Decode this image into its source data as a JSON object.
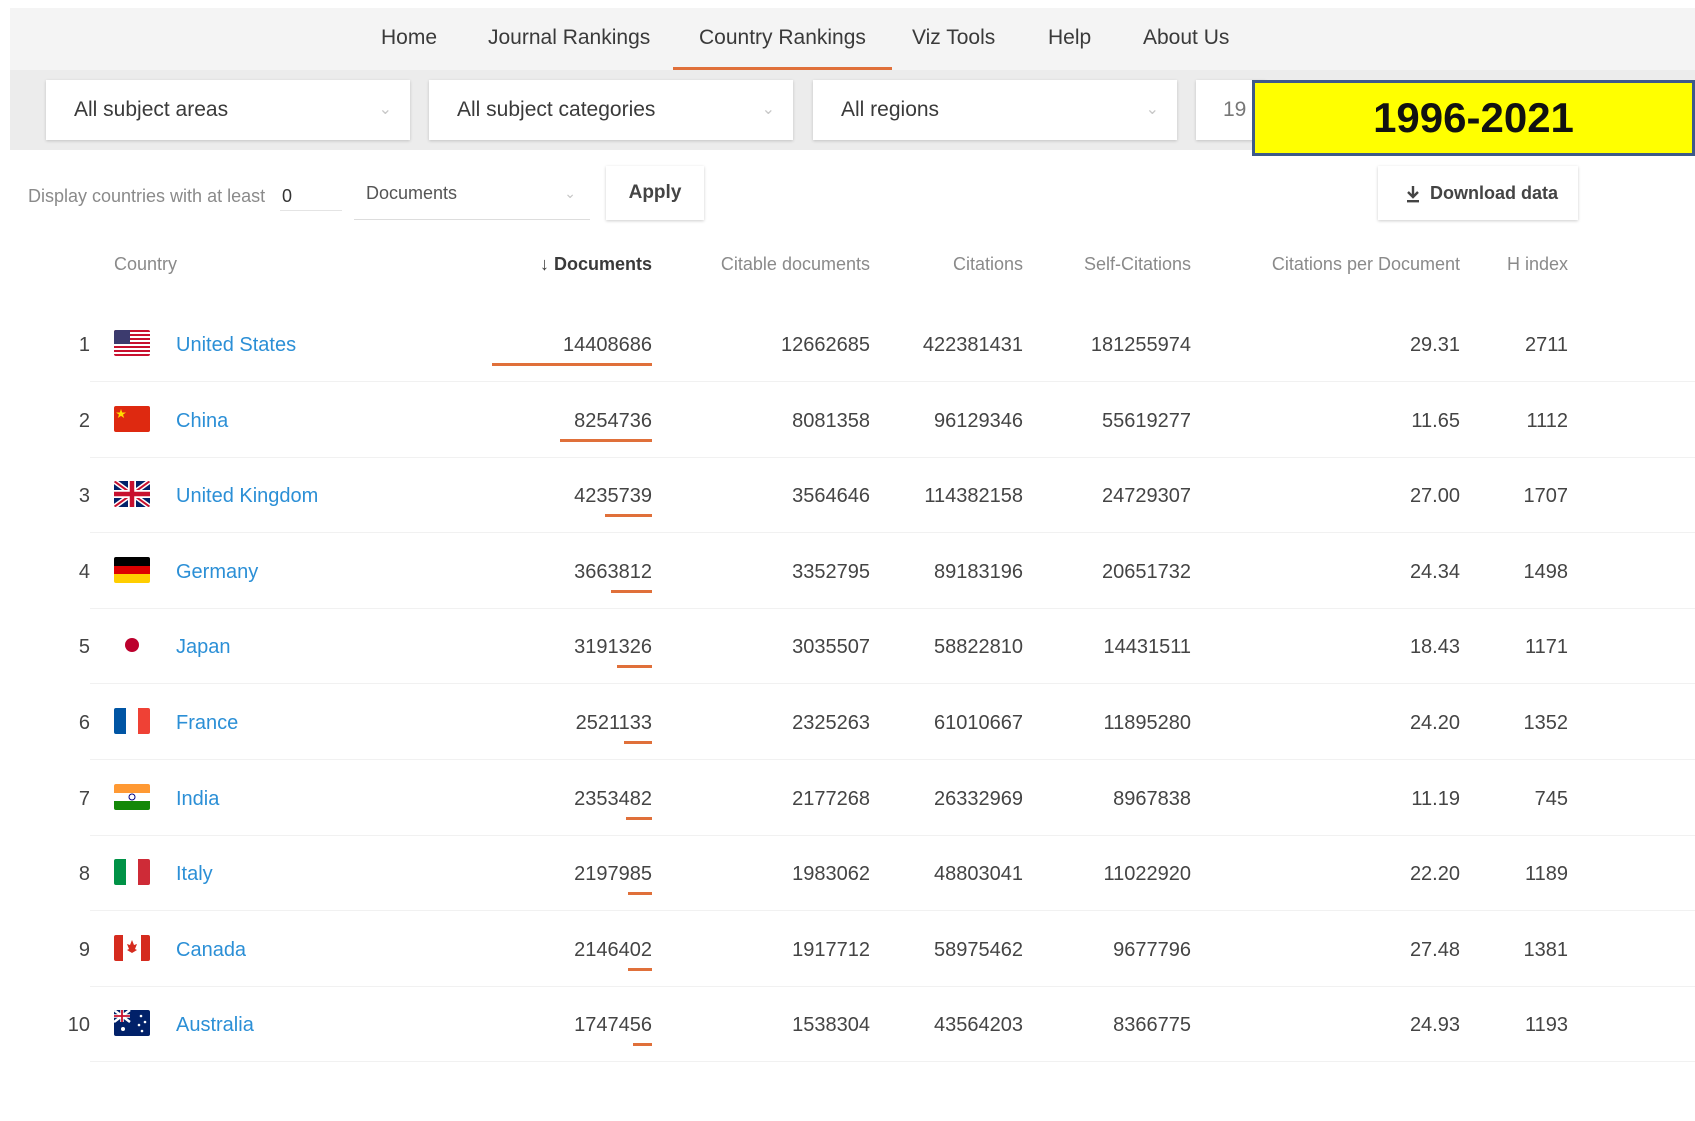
{
  "nav": {
    "items": [
      "Home",
      "Journal Rankings",
      "Country Rankings",
      "Viz Tools",
      "Help",
      "About Us"
    ],
    "active": "Country Rankings"
  },
  "filters": {
    "subject_areas": "All subject areas",
    "subject_categories": "All subject categories",
    "regions": "All regions",
    "year_partial": "19",
    "year_highlight": "1996-2021"
  },
  "options": {
    "display_label": "Display countries with at least",
    "min_value": "0",
    "metric": "Documents",
    "apply_label": "Apply",
    "download_label": "Download data"
  },
  "table": {
    "headers": {
      "country": "Country",
      "documents": "Documents",
      "citable": "Citable documents",
      "citations": "Citations",
      "self_citations": "Self-Citations",
      "cpd": "Citations per Document",
      "hindex": "H index"
    },
    "rows": [
      {
        "rank": "1",
        "country": "United States",
        "flag": "us",
        "documents": "14408686",
        "doc_value": 14408686,
        "citable": "12662685",
        "citations": "422381431",
        "self": "181255974",
        "cpd": "29.31",
        "h": "2711"
      },
      {
        "rank": "2",
        "country": "China",
        "flag": "cn",
        "documents": "8254736",
        "doc_value": 8254736,
        "citable": "8081358",
        "citations": "96129346",
        "self": "55619277",
        "cpd": "11.65",
        "h": "1112"
      },
      {
        "rank": "3",
        "country": "United Kingdom",
        "flag": "gb",
        "documents": "4235739",
        "doc_value": 4235739,
        "citable": "3564646",
        "citations": "114382158",
        "self": "24729307",
        "cpd": "27.00",
        "h": "1707"
      },
      {
        "rank": "4",
        "country": "Germany",
        "flag": "de",
        "documents": "3663812",
        "doc_value": 3663812,
        "citable": "3352795",
        "citations": "89183196",
        "self": "20651732",
        "cpd": "24.34",
        "h": "1498"
      },
      {
        "rank": "5",
        "country": "Japan",
        "flag": "jp",
        "documents": "3191326",
        "doc_value": 3191326,
        "citable": "3035507",
        "citations": "58822810",
        "self": "14431511",
        "cpd": "18.43",
        "h": "1171"
      },
      {
        "rank": "6",
        "country": "France",
        "flag": "fr",
        "documents": "2521133",
        "doc_value": 2521133,
        "citable": "2325263",
        "citations": "61010667",
        "self": "11895280",
        "cpd": "24.20",
        "h": "1352"
      },
      {
        "rank": "7",
        "country": "India",
        "flag": "in",
        "documents": "2353482",
        "doc_value": 2353482,
        "citable": "2177268",
        "citations": "26332969",
        "self": "8967838",
        "cpd": "11.19",
        "h": "745"
      },
      {
        "rank": "8",
        "country": "Italy",
        "flag": "it",
        "documents": "2197985",
        "doc_value": 2197985,
        "citable": "1983062",
        "citations": "48803041",
        "self": "11022920",
        "cpd": "22.20",
        "h": "1189"
      },
      {
        "rank": "9",
        "country": "Canada",
        "flag": "ca",
        "documents": "2146402",
        "doc_value": 2146402,
        "citable": "1917712",
        "citations": "58975462",
        "self": "9677796",
        "cpd": "27.48",
        "h": "1381"
      },
      {
        "rank": "10",
        "country": "Australia",
        "flag": "au",
        "documents": "1747456",
        "doc_value": 1747456,
        "citable": "1538304",
        "citations": "43564203",
        "self": "8366775",
        "cpd": "24.93",
        "h": "1193"
      }
    ]
  },
  "colors": {
    "accent": "#e0703a",
    "link": "#2b8fd6",
    "highlight": "#ffff00"
  }
}
